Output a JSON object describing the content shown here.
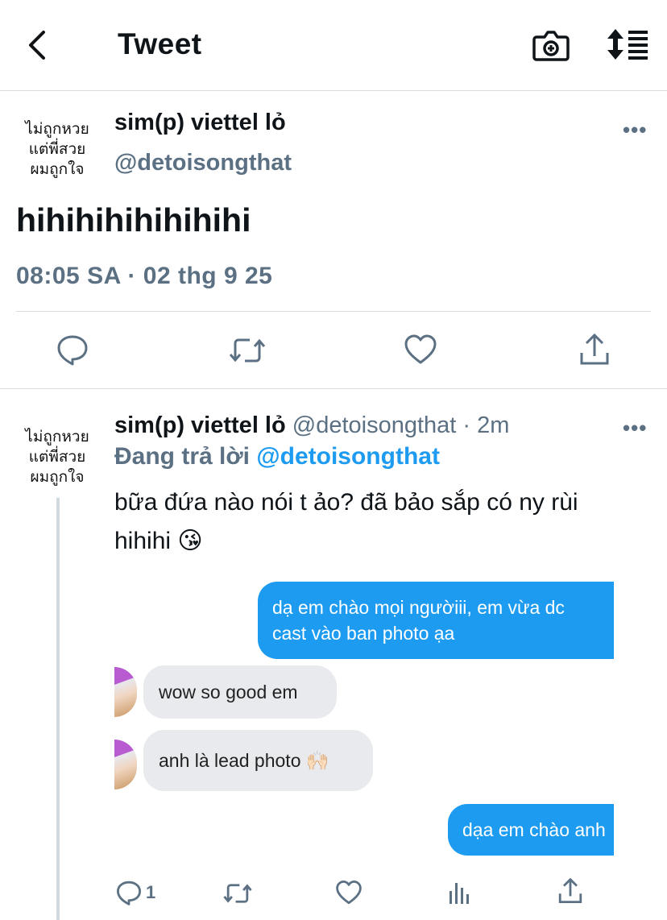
{
  "header": {
    "title": "Tweet"
  },
  "avatar": {
    "lines": [
      "ไม่ถูกหวย",
      "แต่พี่สวย",
      "ผมถูกใจ"
    ]
  },
  "main_tweet": {
    "name": "sim(p) viettel lỏ",
    "handle": "@detoisongthat",
    "text": "hihihihihihihihi",
    "timestamp": "08:05 SA · 02 thg 9 25",
    "more": "•••"
  },
  "reply": {
    "name": "sim(p) viettel lỏ",
    "handle": "@detoisongthat",
    "separator": "·",
    "time": "2m",
    "replying_label": "Đang trả lời",
    "replying_to": "@detoisongthat",
    "text": "bữa đứa nào nói t ảo? đã bảo sắp có ny rùi hihihi 😘",
    "more": "•••",
    "reply_count": "1"
  },
  "chat": {
    "messages": [
      {
        "direction": "out",
        "text": "dạ em chào mọi ngườiii, em vừa dc\ncast vào ban photo ạa"
      },
      {
        "direction": "in",
        "text": "wow so good em"
      },
      {
        "direction": "in",
        "text": "anh là lead photo 🙌🏻"
      },
      {
        "direction": "out",
        "text": "dạa em chào anh"
      }
    ]
  },
  "colors": {
    "accent": "#1d9bf0",
    "secondary_text": "#5b7083",
    "divider": "#d8dcdf",
    "bubble_in": "#e8eaed"
  }
}
